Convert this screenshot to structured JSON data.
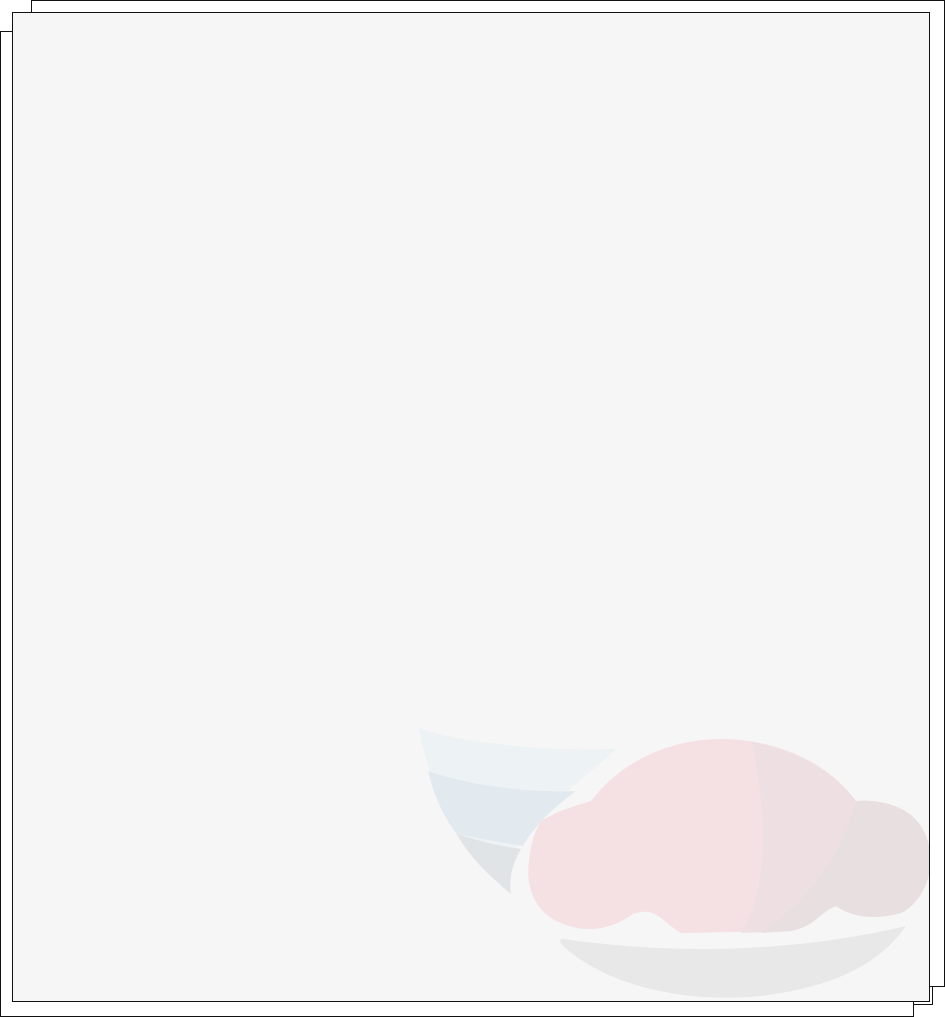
{
  "page": {
    "background_color": "#f6f6f6",
    "border_color": "#111111"
  },
  "watermark": {
    "icon": "food-bowl-icon",
    "colors": {
      "leaf_light": "#edf2f5",
      "leaf_mid": "#e2eaf0",
      "leaf_dark": "#e0e4e6",
      "bun_pink": "#f5e1e3",
      "bun_shade": "#eee0e2",
      "bun_right": "#e8dfe0",
      "plate": "#e8e8e8"
    }
  }
}
